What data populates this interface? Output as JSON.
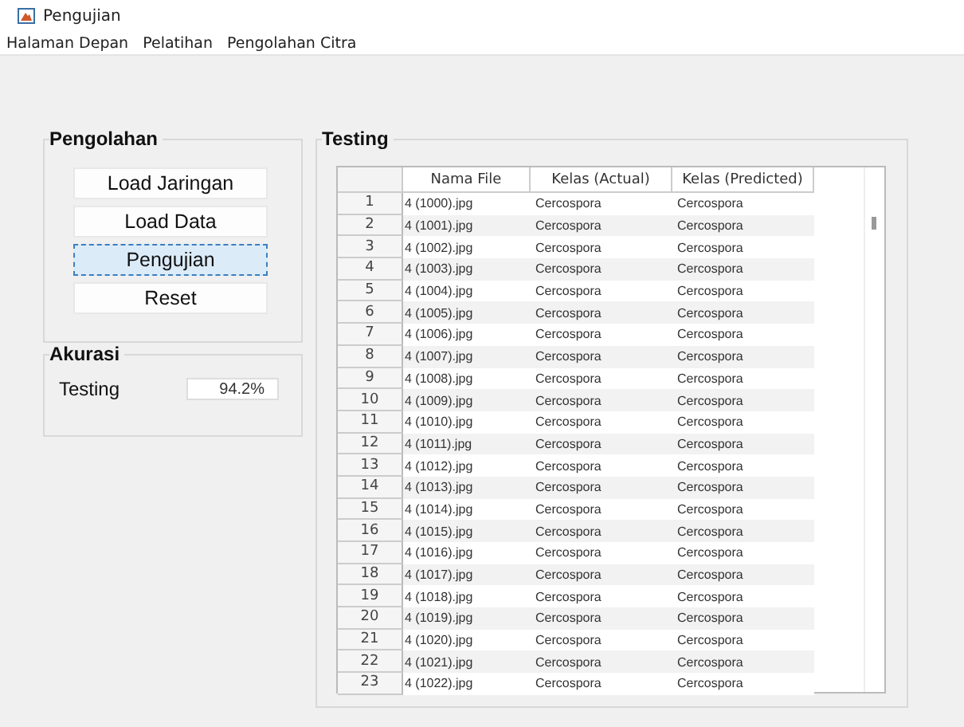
{
  "window": {
    "title": "Pengujian"
  },
  "menu": [
    "Halaman Depan",
    "Pelatihan",
    "Pengolahan Citra"
  ],
  "pengolahan": {
    "title": "Pengolahan",
    "buttons": [
      {
        "label": "Load Jaringan",
        "focused": false
      },
      {
        "label": "Load Data",
        "focused": false
      },
      {
        "label": "Pengujian",
        "focused": true
      },
      {
        "label": "Reset",
        "focused": false
      }
    ]
  },
  "akurasi": {
    "title": "Akurasi",
    "label": "Testing",
    "value": "94.2%"
  },
  "testing": {
    "title": "Testing",
    "table": {
      "columns": [
        "",
        "Nama File",
        "Kelas (Actual)",
        "Kelas (Predicted)"
      ],
      "rows": [
        [
          "1",
          "4 (1000).jpg",
          "Cercospora",
          "Cercospora"
        ],
        [
          "2",
          "4 (1001).jpg",
          "Cercospora",
          "Cercospora"
        ],
        [
          "3",
          "4 (1002).jpg",
          "Cercospora",
          "Cercospora"
        ],
        [
          "4",
          "4 (1003).jpg",
          "Cercospora",
          "Cercospora"
        ],
        [
          "5",
          "4 (1004).jpg",
          "Cercospora",
          "Cercospora"
        ],
        [
          "6",
          "4 (1005).jpg",
          "Cercospora",
          "Cercospora"
        ],
        [
          "7",
          "4 (1006).jpg",
          "Cercospora",
          "Cercospora"
        ],
        [
          "8",
          "4 (1007).jpg",
          "Cercospora",
          "Cercospora"
        ],
        [
          "9",
          "4 (1008).jpg",
          "Cercospora",
          "Cercospora"
        ],
        [
          "10",
          "4 (1009).jpg",
          "Cercospora",
          "Cercospora"
        ],
        [
          "11",
          "4 (1010).jpg",
          "Cercospora",
          "Cercospora"
        ],
        [
          "12",
          "4 (1011).jpg",
          "Cercospora",
          "Cercospora"
        ],
        [
          "13",
          "4 (1012).jpg",
          "Cercospora",
          "Cercospora"
        ],
        [
          "14",
          "4 (1013).jpg",
          "Cercospora",
          "Cercospora"
        ],
        [
          "15",
          "4 (1014).jpg",
          "Cercospora",
          "Cercospora"
        ],
        [
          "16",
          "4 (1015).jpg",
          "Cercospora",
          "Cercospora"
        ],
        [
          "17",
          "4 (1016).jpg",
          "Cercospora",
          "Cercospora"
        ],
        [
          "18",
          "4 (1017).jpg",
          "Cercospora",
          "Cercospora"
        ],
        [
          "19",
          "4 (1018).jpg",
          "Cercospora",
          "Cercospora"
        ],
        [
          "20",
          "4 (1019).jpg",
          "Cercospora",
          "Cercospora"
        ],
        [
          "21",
          "4 (1020).jpg",
          "Cercospora",
          "Cercospora"
        ],
        [
          "22",
          "4 (1021).jpg",
          "Cercospora",
          "Cercospora"
        ],
        [
          "23",
          "4 (1022).jpg",
          "Cercospora",
          "Cercospora"
        ]
      ]
    }
  }
}
